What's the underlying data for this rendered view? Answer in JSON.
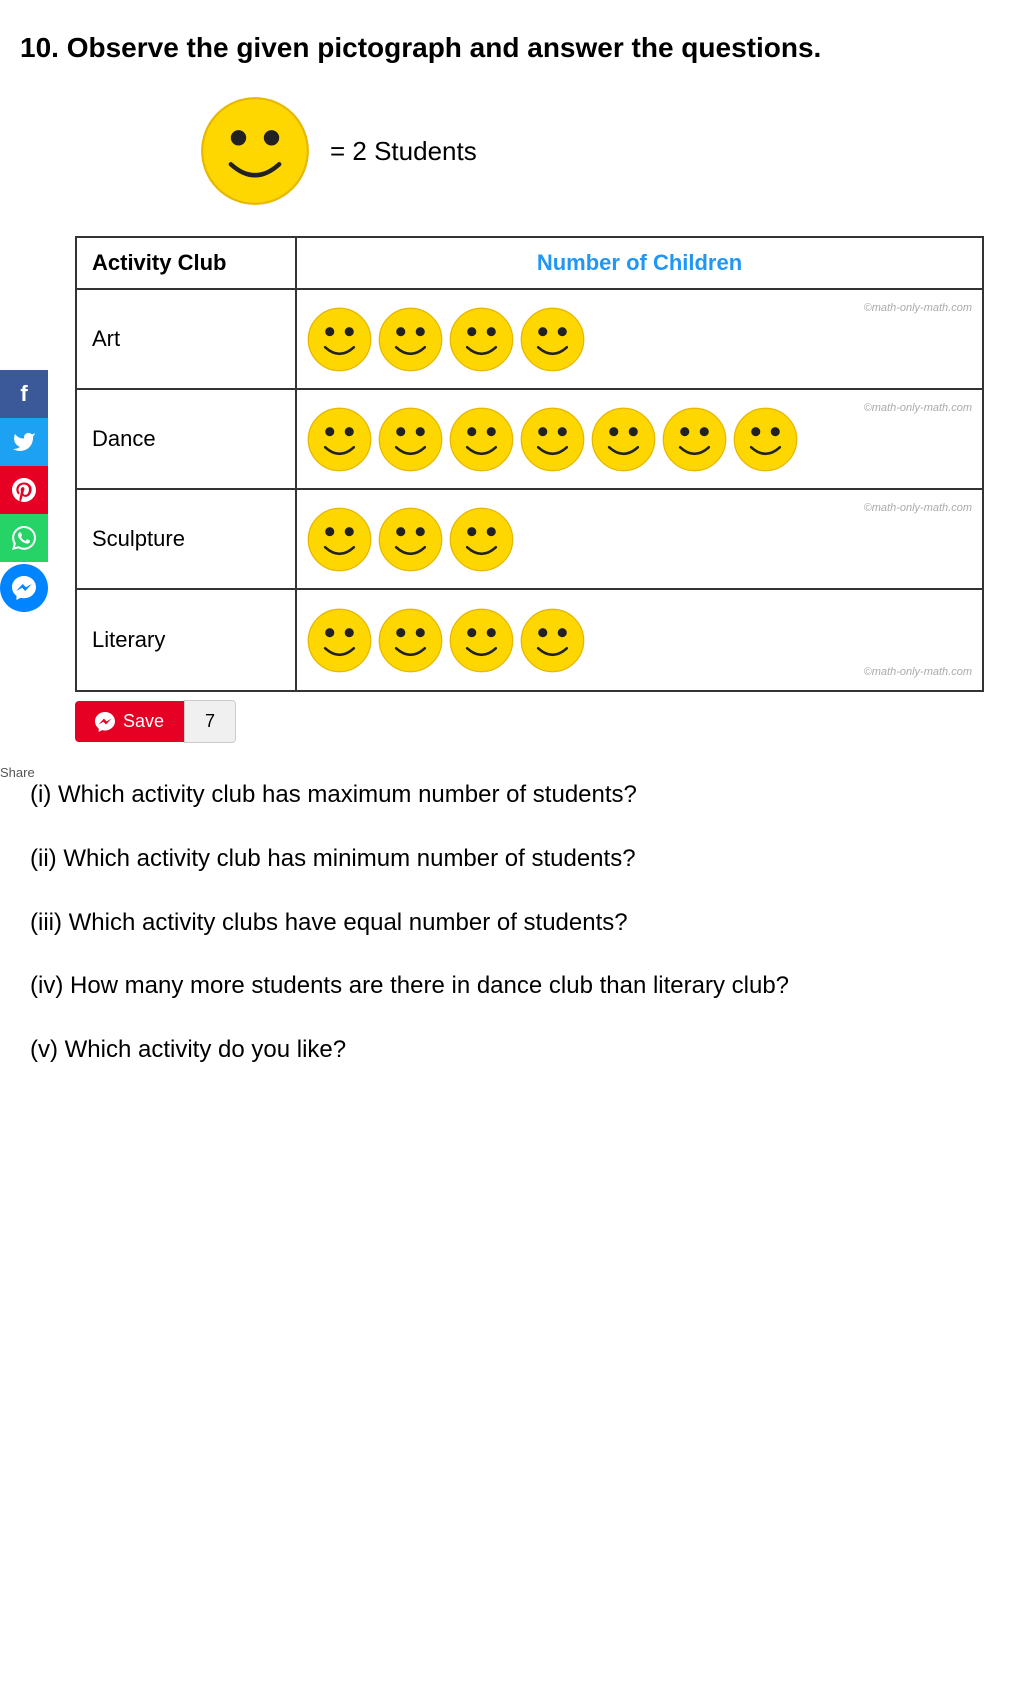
{
  "title": "10. Observe the given pictograph and answer the questions.",
  "legend": {
    "symbol": "smiley",
    "equals_text": "= 2 Students"
  },
  "table": {
    "col1_header": "Activity Club",
    "col2_header": "Number of Children",
    "rows": [
      {
        "club": "Art",
        "count": 4,
        "watermark": "©math-only-math.com"
      },
      {
        "club": "Dance",
        "count": 7,
        "watermark": "©math-only-math.com"
      },
      {
        "club": "Sculpture",
        "count": 3,
        "watermark": "©math-only-math.com"
      },
      {
        "club": "Literary",
        "count": 4,
        "watermark": "©math-only-math.com"
      }
    ]
  },
  "save_bar": {
    "label": "Save",
    "count": "7"
  },
  "questions": [
    "(i) Which activity club has maximum number of students?",
    "(ii) Which activity club has minimum number of students?",
    "(iii) Which activity clubs have equal number of students?",
    "(iv) How many more students are there in dance club than literary club?",
    "(v) Which activity do you like?"
  ],
  "social": {
    "share_label": "Share",
    "buttons": [
      "f",
      "t",
      "p",
      "w",
      "m"
    ]
  },
  "colors": {
    "smiley_face": "#FFD700",
    "header_text": "#2196F3",
    "border": "#333333"
  }
}
